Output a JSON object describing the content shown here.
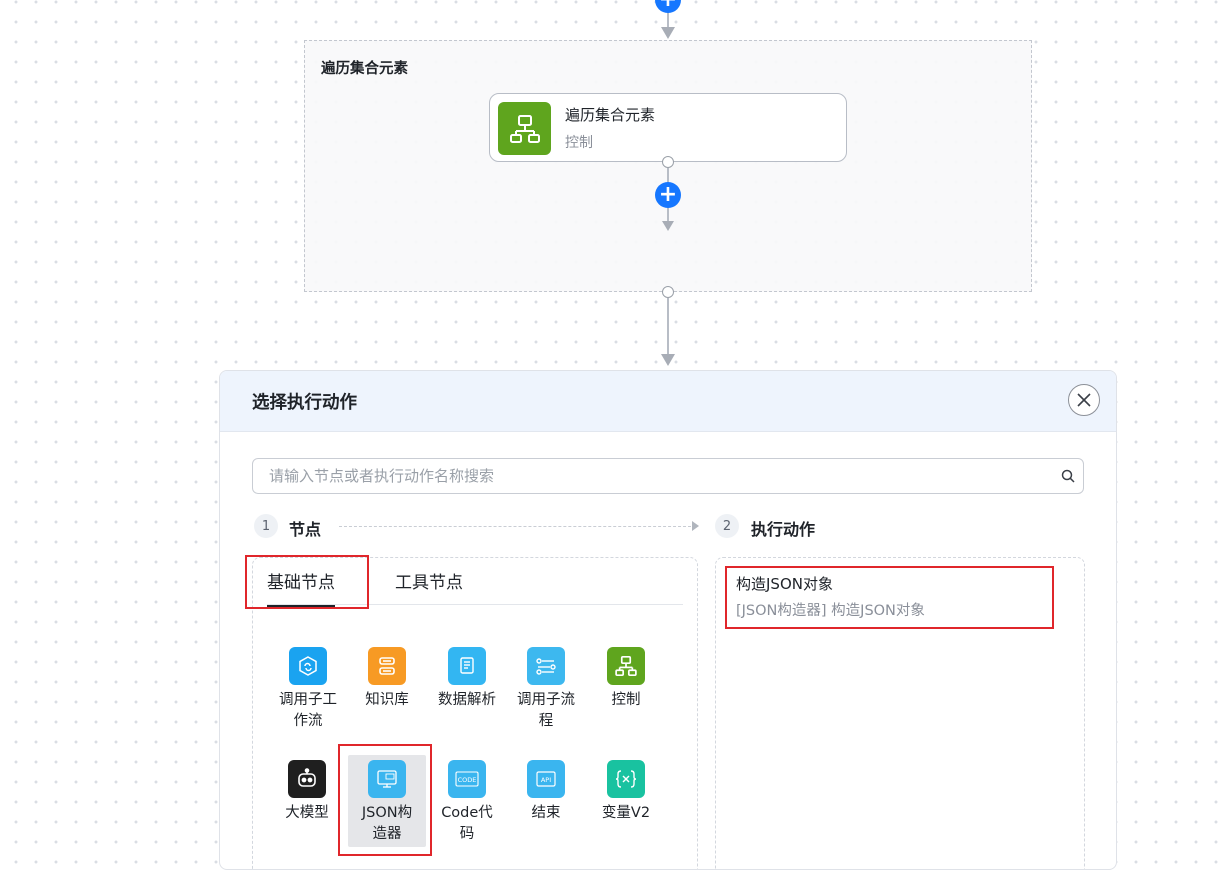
{
  "loop": {
    "title": "遍历集合元素",
    "node_title": "遍历集合元素",
    "node_subtitle": "控制",
    "add_symbol": "+"
  },
  "panel": {
    "title": "选择执行动作",
    "search_placeholder": "请输入节点或者执行动作名称搜索",
    "steps": [
      {
        "num": "1",
        "label": "节点"
      },
      {
        "num": "2",
        "label": "执行动作"
      }
    ],
    "tabs": [
      {
        "label": "基础节点",
        "active": true
      },
      {
        "label": "工具节点",
        "active": false
      }
    ],
    "nodes": [
      {
        "label": "调用子工作流",
        "lines": [
          "调用子工",
          "作流"
        ],
        "icon": "workflow-icon",
        "color": "#1aa3f0"
      },
      {
        "label": "知识库",
        "lines": [
          "知识库"
        ],
        "icon": "database-icon",
        "color": "#f79a24"
      },
      {
        "label": "数据解析",
        "lines": [
          "数据解析"
        ],
        "icon": "data-parse-icon",
        "color": "#33b6f2"
      },
      {
        "label": "调用子流程",
        "lines": [
          "调用子流",
          "程"
        ],
        "icon": "subprocess-icon",
        "color": "#3db8ef"
      },
      {
        "label": "控制",
        "lines": [
          "控制"
        ],
        "icon": "control-icon",
        "color": "#5fa51e"
      },
      {
        "label": "大模型",
        "lines": [
          "大模型"
        ],
        "icon": "robot-icon",
        "color": "#1f1f1f"
      },
      {
        "label": "JSON构造器",
        "lines": [
          "JSON构",
          "造器"
        ],
        "icon": "json-icon",
        "color": "#3ab5ef"
      },
      {
        "label": "Code代码",
        "lines": [
          "Code代",
          "码"
        ],
        "icon": "code-icon",
        "color": "#3ab5ef"
      },
      {
        "label": "结束",
        "lines": [
          "结束"
        ],
        "icon": "api-icon",
        "color": "#3ab5ef"
      },
      {
        "label": "变量V2",
        "lines": [
          "变量V2"
        ],
        "icon": "variable-icon",
        "color": "#19c2a0"
      }
    ],
    "action": {
      "title": "构造JSON对象",
      "subtitle": "[JSON构造器] 构造JSON对象"
    }
  }
}
